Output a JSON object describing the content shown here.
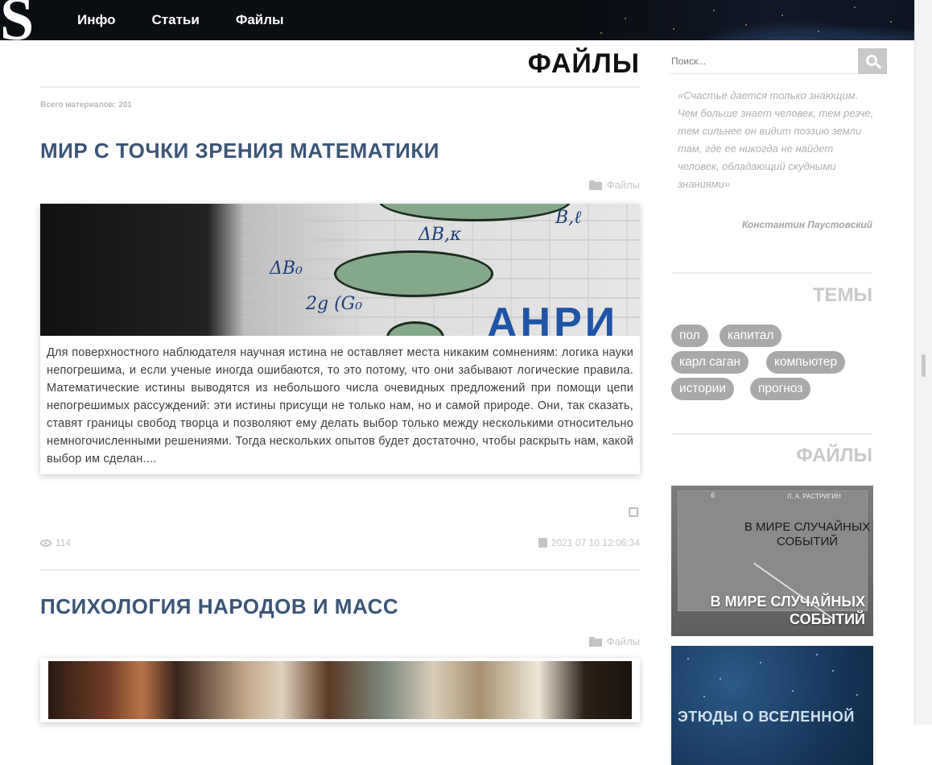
{
  "site": {
    "logo": "S"
  },
  "nav": {
    "items": [
      "Инфо",
      "Статьи",
      "Файлы"
    ]
  },
  "page": {
    "title": "ФАЙЛЫ",
    "total_label": "Всего материалов:",
    "total_value": "201"
  },
  "posts": [
    {
      "title": "МИР С ТОЧКИ ЗРЕНИЯ МАТЕМАТИКИ",
      "category": "Файлы",
      "image_overlay": "АНРИ",
      "excerpt": "Для поверхностного наблюдателя научная истина не оставляет места никаким сомнениям: логика науки непогрешима, и если ученые иногда ошибаются, то это потому, что они забывают логические правила. Математические истины выводятся из небольшого числа очевидных предложений при помощи цепи непогрешимых рассуждений: эти истины присущи не только нам, но и самой природе. Они, так сказать, ставят границы свобод творца и позволяют ему делать выбор только между несколькими относительно немногочисленными решениями. Тогда нескольких опытов будет достаточно, чтобы раскрыть нам, какой выбор им сделан....",
      "views": "114",
      "date": "2021 07 10 12:06:34"
    },
    {
      "title": "ПСИХОЛОГИЯ НАРОДОВ И МАСС",
      "category": "Файлы"
    }
  ],
  "sidebar": {
    "search_placeholder": "Поиск...",
    "quote": "«Счастье дается только знающим. Чем больше знает человек, тем резче, тем сильнее он видит поэзию земли там, где ее никогда не найдет человек, обладающий скудными знаниями»",
    "quote_author": "Константин Паустовский",
    "topics_heading": "ТЕМЫ",
    "tags": [
      "пол",
      "капитал",
      "карл саган",
      "компьютер",
      "истории",
      "прогноз"
    ],
    "files_heading": "ФАЙЛЫ",
    "files": [
      {
        "caption_line1": "В МИРЕ СЛУЧАЙНЫХ",
        "caption_line2": "СОБЫТИЙ",
        "cover_title": "В МИРЕ СЛУЧАЙНЫХ СОБЫТИЙ",
        "cover_author": "Л. А. РАСТРИГИН",
        "cover_num": "6"
      },
      {
        "caption": "ЭТЮДЫ О ВСЕЛЕННОЙ"
      }
    ]
  },
  "colors": {
    "title_blue": "#3a5577",
    "tag_grey": "#a9a9a9",
    "heading_grey": "#c9c9c9"
  }
}
